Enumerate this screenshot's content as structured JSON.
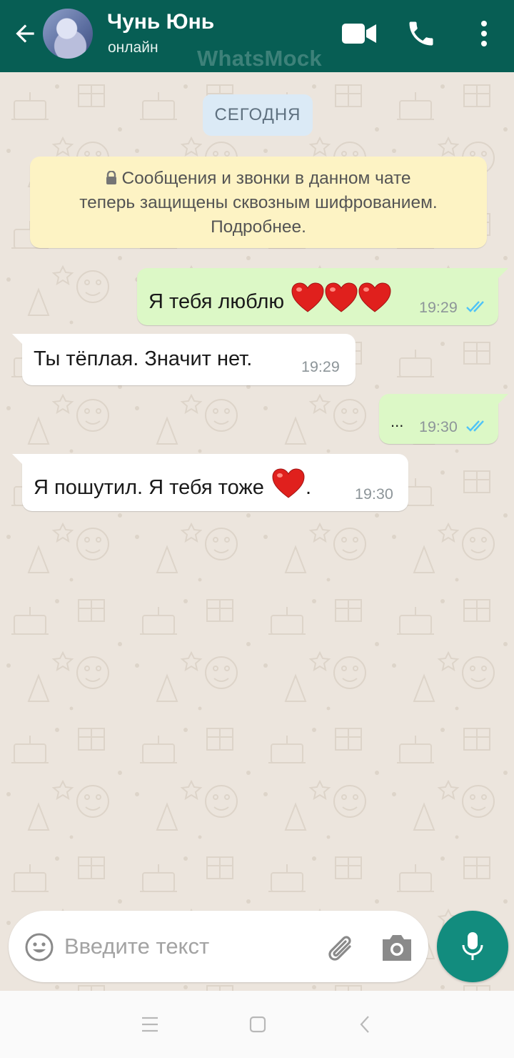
{
  "header": {
    "contact_name": "Чунь Юнь",
    "status": "онлайн",
    "watermark": "WhatsMock",
    "color": "#075e54",
    "icons": [
      "back-arrow-icon",
      "video-camera-icon",
      "phone-icon",
      "more-vertical-icon"
    ]
  },
  "chat": {
    "date_label": "СЕГОДНЯ",
    "encryption_notice": {
      "line1": "Сообщения и звонки в данном чате",
      "line2": "теперь защищены сквозным шифрованием.",
      "line3": "Подробнее.",
      "icon": "lock-icon"
    },
    "messages": [
      {
        "direction": "outgoing",
        "text": "Я тебя люблю",
        "emoji": "❤️❤️❤️",
        "time": "19:29",
        "status": "read"
      },
      {
        "direction": "incoming",
        "text": "Ты тёплая. Значит нет.",
        "time": "19:29"
      },
      {
        "direction": "outgoing",
        "text": "...",
        "time": "19:30",
        "status": "read"
      },
      {
        "direction": "incoming",
        "text": "Я пошутил. Я тебя тоже",
        "emoji": "❤️",
        "text_after": ".",
        "time": "19:30"
      }
    ],
    "colors": {
      "background": "#ece5dd",
      "outgoing_bubble": "#dcf8c6",
      "incoming_bubble": "#ffffff",
      "read_ticks": "#4fc3f7"
    }
  },
  "composer": {
    "placeholder": "Введите текст",
    "value": "",
    "icons": [
      "emoji-icon",
      "paperclip-icon",
      "camera-icon",
      "microphone-icon"
    ],
    "mic_color": "#128c7e"
  },
  "system_nav": {
    "icons": [
      "recents-icon",
      "home-icon",
      "back-icon"
    ]
  }
}
